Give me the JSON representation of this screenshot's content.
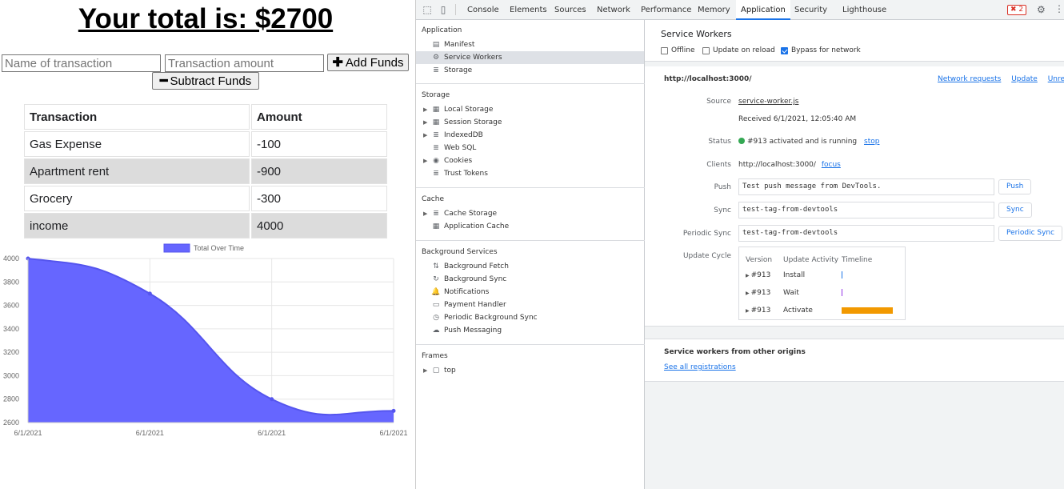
{
  "app": {
    "total_label": "Your total is: $2700",
    "name_placeholder": "Name of transaction",
    "amount_placeholder": "Transaction amount",
    "add_label": "Add Funds",
    "subtract_label": "Subtract Funds",
    "table_headers": [
      "Transaction",
      "Amount"
    ],
    "transactions": [
      {
        "name": "Gas Expense",
        "amount": "-100"
      },
      {
        "name": "Apartment rent",
        "amount": "-900"
      },
      {
        "name": "Grocery",
        "amount": "-300"
      },
      {
        "name": "income",
        "amount": "4000"
      }
    ]
  },
  "chart_data": {
    "type": "area",
    "categories": [
      "6/1/2021",
      "6/1/2021",
      "6/1/2021",
      "6/1/2021"
    ],
    "series": [
      {
        "name": "Total Over Time",
        "values": [
          4000,
          3700,
          2800,
          2700
        ],
        "color": "#6666ff"
      }
    ],
    "ylim": [
      2600,
      4000
    ],
    "yticks": [
      2600,
      2800,
      3000,
      3200,
      3400,
      3600,
      3800,
      4000
    ],
    "grid": true,
    "legend": "top"
  },
  "devtools": {
    "tabs": [
      "Console",
      "Elements",
      "Sources",
      "Network",
      "Performance",
      "Memory",
      "Application",
      "Security",
      "Lighthouse"
    ],
    "active_tab": "Application",
    "error_count": "2",
    "sidebar": {
      "application_title": "Application",
      "application_items": [
        {
          "label": "Manifest",
          "icon": "file-icon"
        },
        {
          "label": "Service Workers",
          "icon": "gear-icon"
        },
        {
          "label": "Storage",
          "icon": "database-icon"
        }
      ],
      "storage_title": "Storage",
      "storage_items": [
        {
          "label": "Local Storage",
          "icon": "grid-icon"
        },
        {
          "label": "Session Storage",
          "icon": "grid-icon"
        },
        {
          "label": "IndexedDB",
          "icon": "database-icon"
        },
        {
          "label": "Web SQL",
          "icon": "database-icon"
        },
        {
          "label": "Cookies",
          "icon": "cookie-icon"
        },
        {
          "label": "Trust Tokens",
          "icon": "database-icon"
        }
      ],
      "cache_title": "Cache",
      "cache_items": [
        {
          "label": "Cache Storage",
          "icon": "database-icon"
        },
        {
          "label": "Application Cache",
          "icon": "grid-icon"
        }
      ],
      "bg_title": "Background Services",
      "bg_items": [
        {
          "label": "Background Fetch",
          "icon": "arrows-icon"
        },
        {
          "label": "Background Sync",
          "icon": "sync-icon"
        },
        {
          "label": "Notifications",
          "icon": "bell-icon"
        },
        {
          "label": "Payment Handler",
          "icon": "card-icon"
        },
        {
          "label": "Periodic Background Sync",
          "icon": "clock-icon"
        },
        {
          "label": "Push Messaging",
          "icon": "cloud-icon"
        }
      ],
      "frames_title": "Frames",
      "frames_items": [
        {
          "label": "top",
          "icon": "frame-icon"
        }
      ]
    },
    "sw": {
      "title": "Service Workers",
      "offline_label": "Offline",
      "update_on_reload_label": "Update on reload",
      "bypass_label": "Bypass for network",
      "origin": "http://localhost:3000/",
      "network_requests": "Network requests",
      "update": "Update",
      "unregister": "Unregi",
      "source_label": "Source",
      "source_link": "service-worker.js",
      "received": "Received 6/1/2021, 12:05:40 AM",
      "status_label": "Status",
      "status_text": "#913 activated and is running",
      "stop": "stop",
      "clients_label": "Clients",
      "clients_value": "http://localhost:3000/",
      "focus": "focus",
      "push_label": "Push",
      "push_value": "Test push message from DevTools.",
      "push_btn": "Push",
      "sync_label": "Sync",
      "sync_value": "test-tag-from-devtools",
      "sync_btn": "Sync",
      "periodic_label": "Periodic Sync",
      "periodic_value": "test-tag-from-devtools",
      "periodic_btn": "Periodic Sync",
      "update_cycle_label": "Update Cycle",
      "uc_headers": [
        "Version",
        "Update Activity",
        "Timeline"
      ],
      "uc_rows": [
        {
          "version": "#913",
          "activity": "Install"
        },
        {
          "version": "#913",
          "activity": "Wait"
        },
        {
          "version": "#913",
          "activity": "Activate"
        }
      ],
      "other_title": "Service workers from other origins",
      "see_all": "See all registrations"
    }
  }
}
